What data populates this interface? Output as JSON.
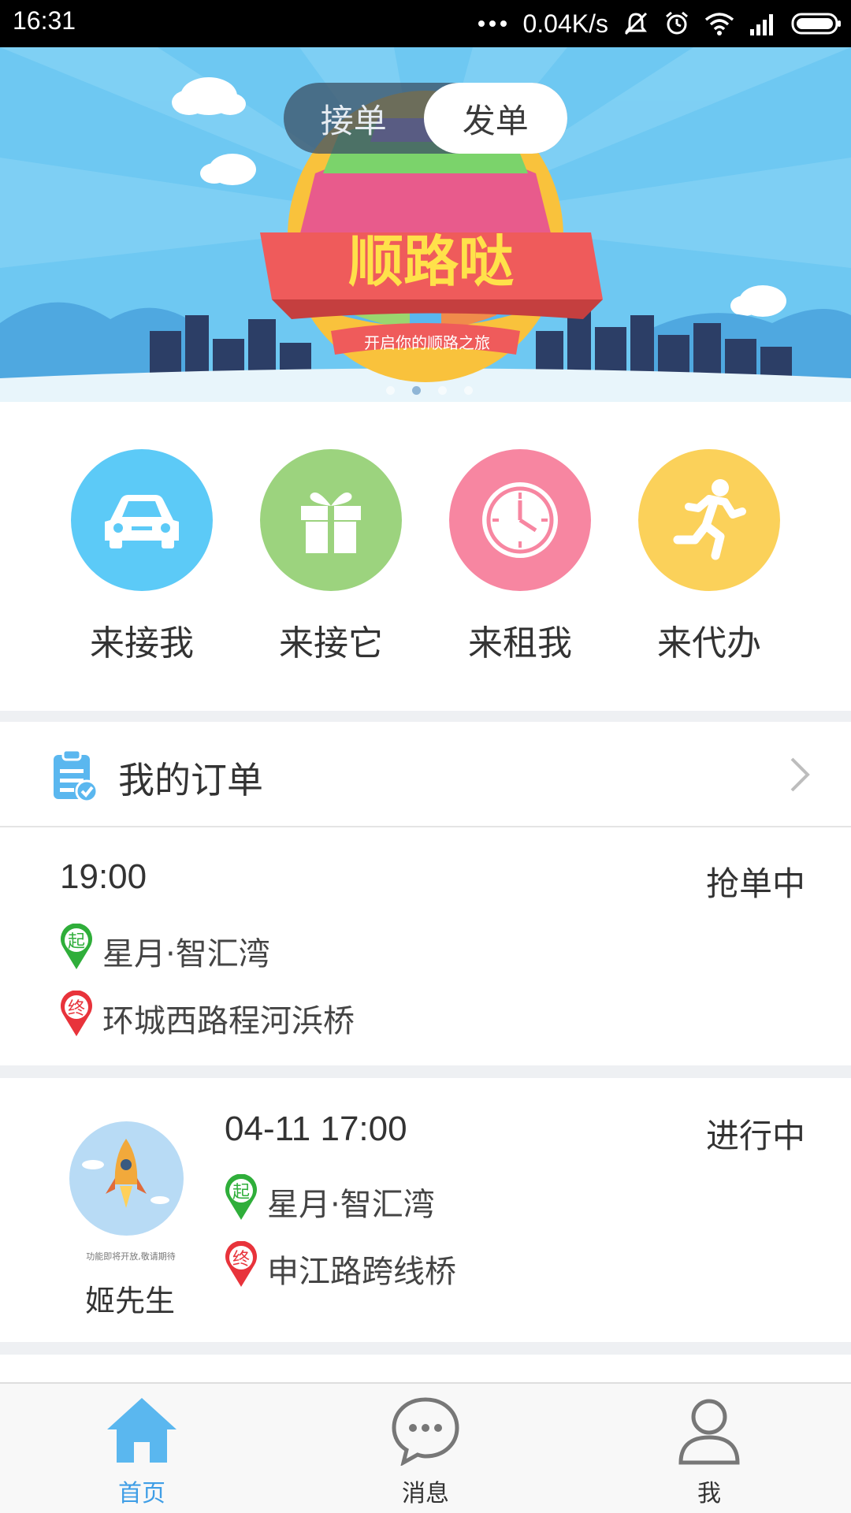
{
  "status_bar": {
    "time": "16:31",
    "net_speed": "0.04K/s",
    "icons": [
      "more-dots-icon",
      "mute-icon",
      "alarm-icon",
      "wifi-icon",
      "signal-icon",
      "battery-icon"
    ]
  },
  "banner": {
    "toggle": {
      "options": [
        "接单",
        "发单"
      ],
      "selected": "发单"
    },
    "title": "顺路哒",
    "subtitle": "开启你的顺路之旅",
    "page_count": 4,
    "current_page": 2
  },
  "categories": [
    {
      "label": "来接我",
      "icon": "car-icon",
      "color": "#5ccaf7"
    },
    {
      "label": "来接它",
      "icon": "gift-icon",
      "color": "#9cd37e"
    },
    {
      "label": "来租我",
      "icon": "clock-icon",
      "color": "#f786a1"
    },
    {
      "label": "来代办",
      "icon": "running-man-icon",
      "color": "#fbd15a"
    }
  ],
  "orders": {
    "header": "我的订单",
    "items": [
      {
        "time": "19:00",
        "status": "抢单中",
        "start": "星月·智汇湾",
        "end": "环城西路程河浜桥"
      },
      {
        "time": "04-11 17:00",
        "status": "进行中",
        "start": "星月·智汇湾",
        "end": "申江路跨线桥",
        "user_name": "姬先生",
        "avatar_caption": "功能即将开放,敬请期待"
      }
    ],
    "start_marker": "起",
    "end_marker": "终"
  },
  "tabbar": {
    "tabs": [
      {
        "label": "首页",
        "icon": "home-icon",
        "active": true
      },
      {
        "label": "消息",
        "icon": "message-icon",
        "active": false
      },
      {
        "label": "我",
        "icon": "profile-icon",
        "active": false
      }
    ],
    "active_color": "#3f9ee6"
  }
}
